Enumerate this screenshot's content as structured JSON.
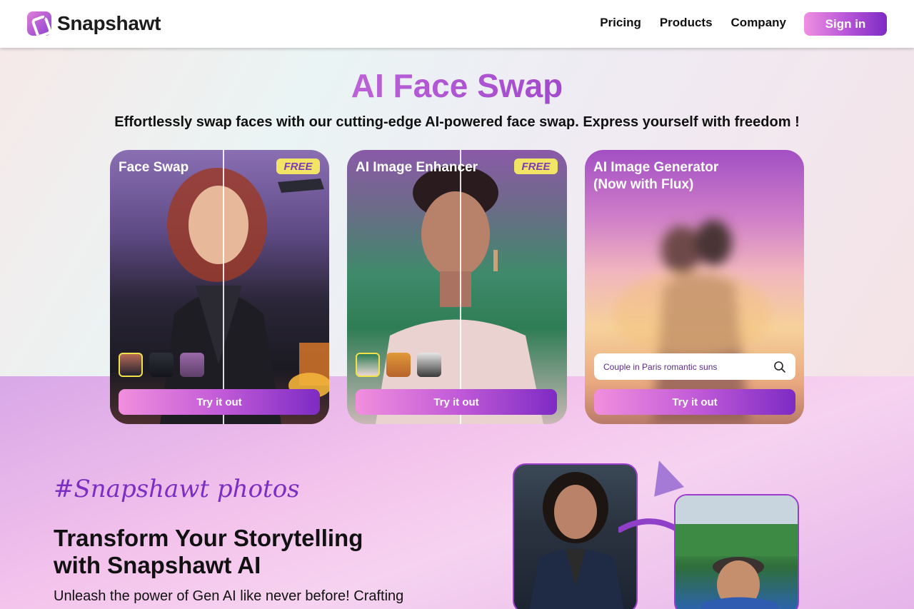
{
  "header": {
    "brand": "Snapshawt",
    "nav": [
      "Pricing",
      "Products",
      "Company"
    ],
    "signin_label": "Sign in"
  },
  "hero": {
    "title": "AI Face Swap",
    "subtitle": "Effortlessly swap faces with our cutting-edge AI-powered face swap. Express yourself with freedom !"
  },
  "cards": [
    {
      "title": "Face Swap",
      "badge": "FREE",
      "cta": "Try it out"
    },
    {
      "title": "AI Image Enhancer",
      "badge": "FREE",
      "cta": "Try it out"
    },
    {
      "title_line1": "AI Image Generator",
      "title_line2": "(Now with Flux)",
      "prompt": "Couple in Paris romantic suns",
      "cta": "Try it out"
    }
  ],
  "section": {
    "tag": "#Snapshawt photos",
    "title_line1": "Transform Your Storytelling",
    "title_line2": "with Snapshawt AI",
    "description": "Unleash the power of Gen AI like never before! Crafting"
  },
  "colors": {
    "accent_start": "#f08fdc",
    "accent_end": "#7d2bc4",
    "badge": "#f2e566"
  },
  "icons": {
    "search": "search-icon"
  }
}
